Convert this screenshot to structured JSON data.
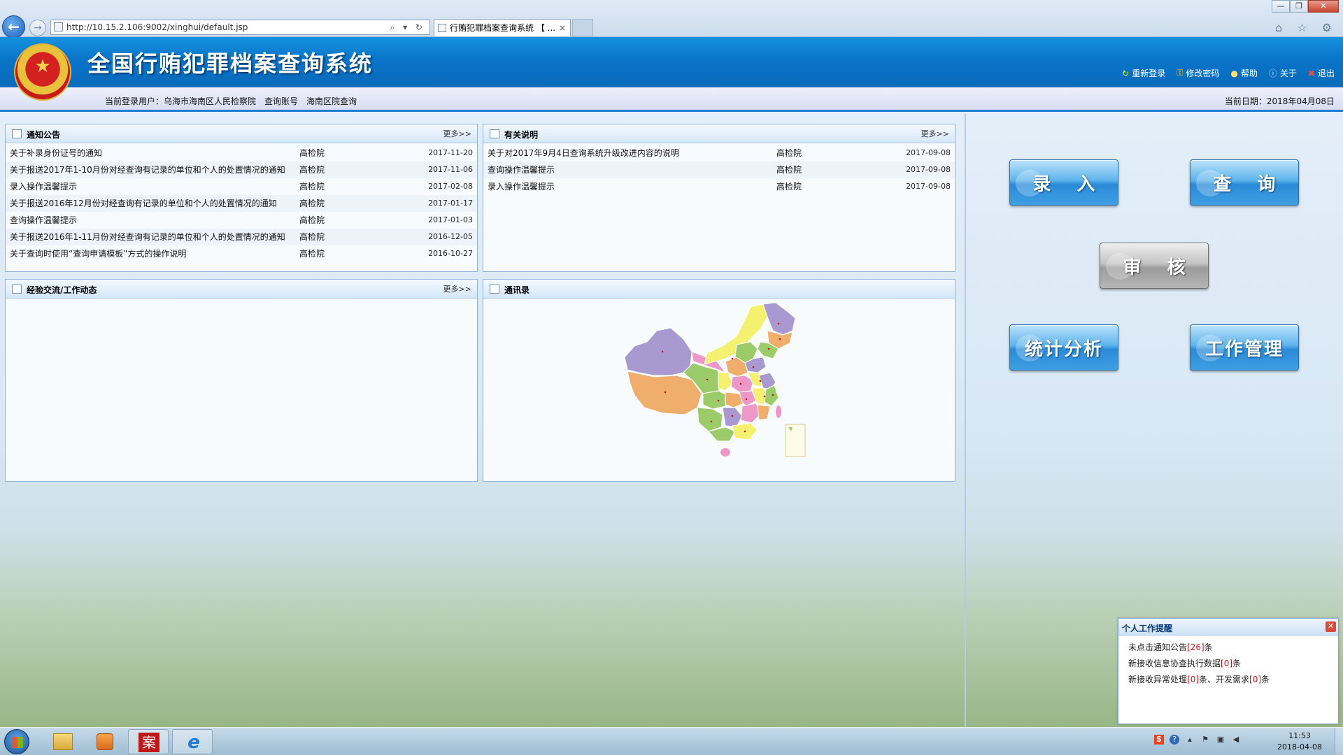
{
  "browser": {
    "url": "http://10.15.2.106:9002/xinghui/default.jsp",
    "tab_title": "行贿犯罪档案查询系统 【 ...",
    "tab_close": "×",
    "back_glyph": "←",
    "forward_glyph": "→",
    "addr_tools": "⌕ ▾ ↻",
    "right_tools": "⌂ ☆ ⚙",
    "window_controls": {
      "minimize": "—",
      "restore": "❐",
      "close": "✕"
    }
  },
  "header": {
    "title": "全国行贿犯罪档案查询系统",
    "links": [
      {
        "icon": "refresh-icon",
        "glyph": "↻",
        "label": "重新登录"
      },
      {
        "icon": "key-icon",
        "glyph": "⚿",
        "label": "修改密码"
      },
      {
        "icon": "help-icon",
        "glyph": "●",
        "label": "帮助"
      },
      {
        "icon": "info-icon",
        "glyph": "ⓘ",
        "label": "关于"
      },
      {
        "icon": "exit-icon",
        "glyph": "✖",
        "label": "退出"
      }
    ]
  },
  "info_bar": {
    "user_label": "当前登录用户：",
    "user_value": "乌海市海南区人民检察院",
    "account_label": "查询账号",
    "account_value": "海南区院查询",
    "date_label": "当前日期：",
    "date_value": "2018年04月08日"
  },
  "panels": {
    "notices": {
      "title": "通知公告",
      "more": "更多>>",
      "rows": [
        {
          "title": "关于补录身份证号的通知",
          "source": "高检院",
          "date": "2017-11-20"
        },
        {
          "title": "关于报送2017年1-10月份对经查询有记录的单位和个人的处置情况的通知",
          "source": "高检院",
          "date": "2017-11-06"
        },
        {
          "title": "录入操作温馨提示",
          "source": "高检院",
          "date": "2017-02-08"
        },
        {
          "title": "关于报送2016年12月份对经查询有记录的单位和个人的处置情况的通知",
          "source": "高检院",
          "date": "2017-01-17"
        },
        {
          "title": "查询操作温馨提示",
          "source": "高检院",
          "date": "2017-01-03"
        },
        {
          "title": "关于报送2016年1-11月份对经查询有记录的单位和个人的处置情况的通知",
          "source": "高检院",
          "date": "2016-12-05"
        },
        {
          "title": "关于查询时使用“查询申请模板”方式的操作说明",
          "source": "高检院",
          "date": "2016-10-27"
        }
      ]
    },
    "explain": {
      "title": "有关说明",
      "more": "更多>>",
      "rows": [
        {
          "title": "关于对2017年9月4日查询系统升级改进内容的说明",
          "source": "高检院",
          "date": "2017-09-08"
        },
        {
          "title": "查询操作温馨提示",
          "source": "高检院",
          "date": "2017-09-08"
        },
        {
          "title": "录入操作温馨提示",
          "source": "高检院",
          "date": "2017-09-08"
        }
      ]
    },
    "exchange": {
      "title": "经验交流/工作动态",
      "more": "更多>>"
    },
    "contacts": {
      "title": "通讯录"
    }
  },
  "actions": {
    "entry": [
      "录",
      "入"
    ],
    "query": [
      "查",
      "询"
    ],
    "review": [
      "审",
      "核"
    ],
    "stats": "统计分析",
    "work": "工作管理"
  },
  "reminder": {
    "title": "个人工作提醒",
    "close": "✕",
    "unread_prefix": "未点击通知公告",
    "unread_count": "[26]",
    "unread_suffix": "条",
    "assist_prefix": "新接收信息协查执行数据",
    "assist_count": "[0]",
    "assist_suffix": "条",
    "abnormal_prefix": "新接收异常处理",
    "abnormal_count": "[0]",
    "abnormal_mid": "条、开发需求",
    "dev_count": "[0]",
    "dev_suffix": "条"
  },
  "taskbar": {
    "archive_glyph": "案",
    "ie_glyph": "e",
    "clock_time": "11:53",
    "clock_date": "2018-04-08",
    "tray_s": "S",
    "tray_help": "?"
  },
  "colors": {
    "header_blue": "#0a74c8",
    "panel_border": "#8fb5dc",
    "reminder_number": "#d01010",
    "map_purple": "#a89ad0",
    "map_orange": "#f0ae6c",
    "map_green": "#9ccc6a",
    "map_yellow": "#f4f070",
    "map_pink": "#ee98c8"
  }
}
